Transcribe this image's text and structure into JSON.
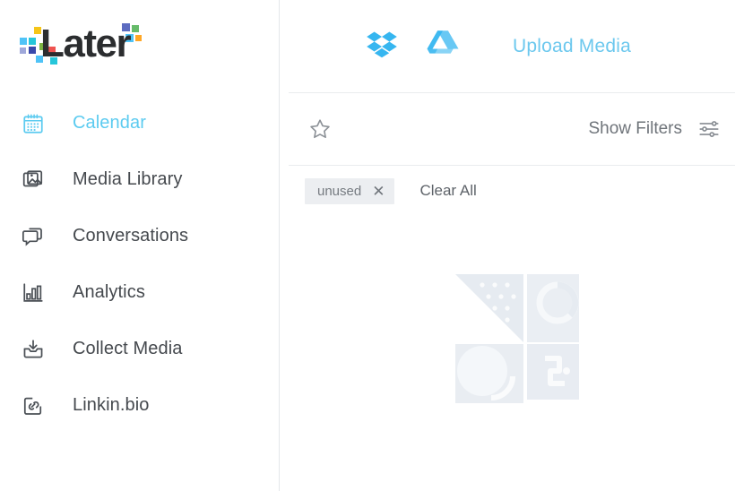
{
  "brand": {
    "logo_text": "Later",
    "logo_colors": [
      "#f5c518",
      "#4fc3f7",
      "#3949ab",
      "#7cb342",
      "#ef5350",
      "#26c6da",
      "#5c6bc0",
      "#66bb6a",
      "#ffa726"
    ],
    "wordmark_color": "#2b2d2f"
  },
  "colors": {
    "accent_blue": "#5ccbf0",
    "upload_link": "#6cc8ee",
    "arrow_pink": "#f2487d",
    "sidebar_icon": "#4b5056",
    "text_dark": "#45494e",
    "text_muted": "#6f747a",
    "divider": "#e9ecee",
    "tag_bg": "#eceef1",
    "placeholder": "#e3e8ee"
  },
  "sidebar": {
    "items": [
      {
        "label": "Calendar",
        "icon": "calendar-icon",
        "active": true
      },
      {
        "label": "Media Library",
        "icon": "photos-stack-icon",
        "active": false
      },
      {
        "label": "Conversations",
        "icon": "chat-bubbles-icon",
        "active": false
      },
      {
        "label": "Analytics",
        "icon": "bar-chart-icon",
        "active": false
      },
      {
        "label": "Collect Media",
        "icon": "inbox-download-icon",
        "active": false
      },
      {
        "label": "Linkin.bio",
        "icon": "link-square-icon",
        "active": false
      }
    ]
  },
  "topbar": {
    "dropbox_icon": "dropbox-icon",
    "google_drive_icon": "google-drive-icon",
    "upload_label": "Upload Media",
    "annotation_arrow": "pink-arrow-pointing-left"
  },
  "filterbar": {
    "favorite_icon": "star-outline-icon",
    "show_filters_label": "Show Filters",
    "filters_icon": "sliders-icon"
  },
  "tagbar": {
    "tags": [
      {
        "label": "unused",
        "remove_icon": "close-icon"
      }
    ],
    "clear_all_label": "Clear All"
  },
  "content": {
    "empty_placeholder": "media-placeholder-illustration"
  }
}
